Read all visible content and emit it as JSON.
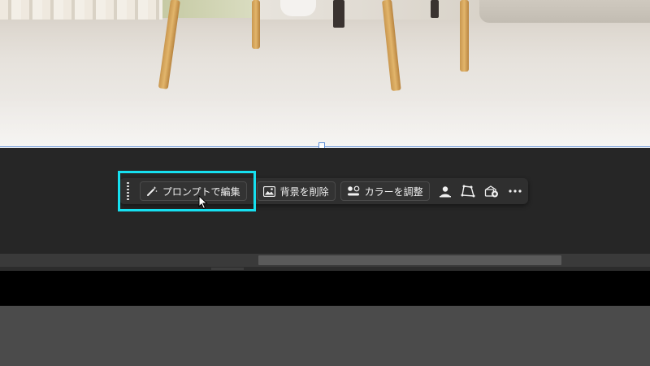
{
  "toolbar": {
    "edit_with_prompt_label": "プロンプトで編集",
    "remove_background_label": "背景を削除",
    "adjust_color_label": "カラーを調整"
  },
  "icons": {
    "grip": "drag-handle-icon",
    "edit_with_prompt": "magic-wand-icon",
    "remove_background": "image-icon",
    "adjust_color": "color-adjust-icon",
    "person": "person-icon",
    "perspective": "perspective-crop-icon",
    "add_image": "image-add-icon",
    "more": "more-icon"
  },
  "colors": {
    "highlight": "#16e0f0",
    "selection": "#5e8fd8",
    "toolbar_bg": "#2f2f2f",
    "workspace_bg": "#262626"
  }
}
